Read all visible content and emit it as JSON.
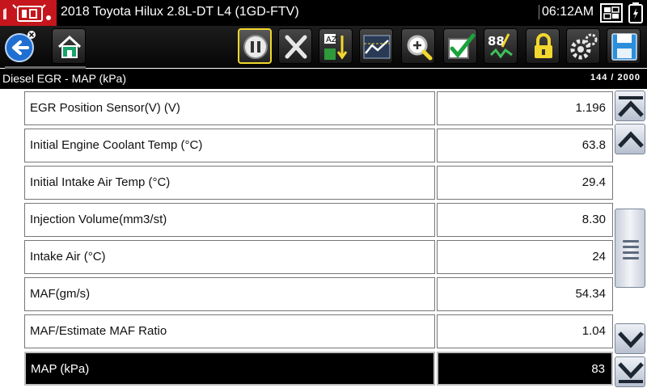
{
  "titlebar": {
    "vehicle": "2018 Toyota Hilux 2.8L-DT L4 (1GD-FTV)",
    "clock": "06:12AM",
    "icons": [
      "vehicle-logo-icon",
      "connection-icon",
      "battery-icon"
    ]
  },
  "toolbar": {
    "buttons": [
      "back-icon",
      "home-icon",
      "pause-icon",
      "close-icon",
      "sort-icon",
      "graph-icon",
      "zoom-icon",
      "check-icon",
      "custom-data-icon",
      "lock-icon",
      "settings-icon",
      "save-icon"
    ],
    "selected": "pause-icon"
  },
  "header": {
    "pid_title": "Diesel EGR - MAP (kPa)",
    "pid_count": "144 / 2000"
  },
  "rows": [
    {
      "name": "EGR Position Sensor(V) (V)",
      "value": "1.196"
    },
    {
      "name": "Initial Engine Coolant Temp (°C)",
      "value": "63.8"
    },
    {
      "name": "Initial Intake Air Temp (°C)",
      "value": "29.4"
    },
    {
      "name": "Injection Volume(mm3/st)",
      "value": "8.30"
    },
    {
      "name": "Intake Air (°C)",
      "value": "24"
    },
    {
      "name": "MAF(gm/s)",
      "value": "54.34"
    },
    {
      "name": "MAF/Estimate MAF Ratio",
      "value": "1.04"
    },
    {
      "name": "MAP (kPa)",
      "value": "83"
    }
  ],
  "selected_row": 7,
  "scrollbar": {
    "icons": [
      "scroll-top-icon",
      "scroll-up-icon",
      "scroll-down-icon",
      "scroll-bottom-icon"
    ]
  },
  "colors": {
    "logo_red": "#c4161c",
    "selection_yellow": "#f2d72e",
    "selected_row_bg": "#000000"
  }
}
